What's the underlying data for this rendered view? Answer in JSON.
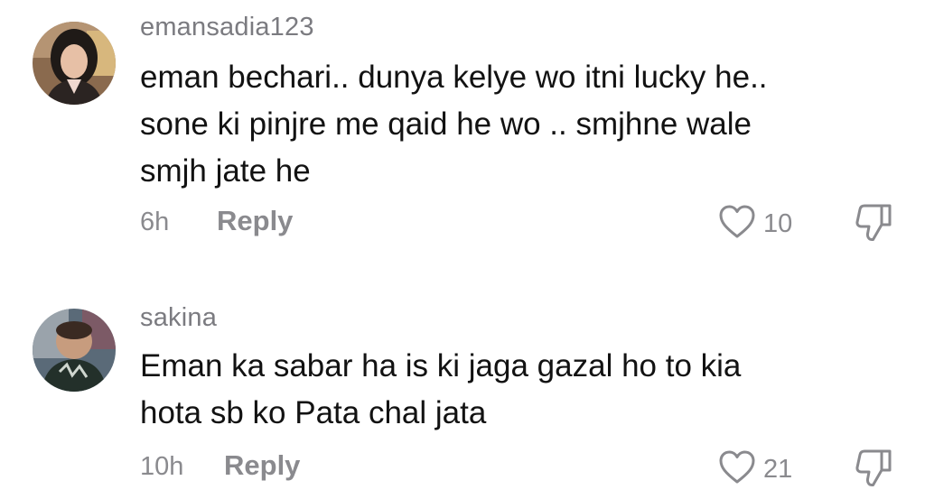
{
  "comments": [
    {
      "username": "emansadia123",
      "text": "eman bechari.. dunya kelye wo itni lucky he..\nsone ki pinjre me qaid he wo .. smjhne wale\nsmjh jate he",
      "time": "6h",
      "reply_label": "Reply",
      "likes": "10"
    },
    {
      "username": "sakina",
      "text": "Eman ka sabar ha is ki jaga gazal ho to kia\nhota sb ko Pata chal jata",
      "time": "10h",
      "reply_label": "Reply",
      "likes": "21"
    }
  ],
  "icons": {
    "like": "heart-outline-icon",
    "dislike": "thumbs-down-outline-icon"
  }
}
